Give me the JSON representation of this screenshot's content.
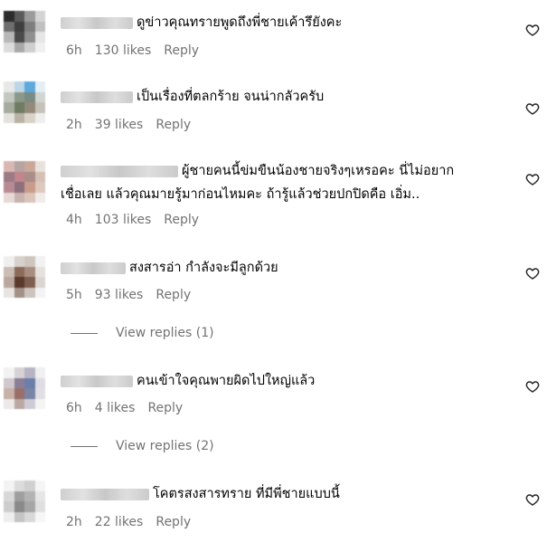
{
  "comments": [
    {
      "text_line1": "ดูข่าวคุณทรายพูดถึงพี่ชายเค้ารึยังคะ",
      "text_line2": "",
      "time": "6h",
      "likes": "130 likes",
      "reply": "Reply"
    },
    {
      "text_line1": "เป็นเรื่องที่ตลกร้าย จนน่ากลัวครับ",
      "text_line2": "",
      "time": "2h",
      "likes": "39 likes",
      "reply": "Reply"
    },
    {
      "text_line1": "ผู้ชายคนนี้ข่มขืนน้องชายจริงๆเหรอคะ นี่ไม่อยาก",
      "text_line2": "เชื่อเลย แล้วคุณมายรู้มาก่อนไหมคะ ถ้ารู้แล้วช่วยปกปิดคือ เอิ่ม..",
      "time": "4h",
      "likes": "103 likes",
      "reply": "Reply"
    },
    {
      "text_line1": "สงสารอ่า กำลังจะมีลูกด้วย",
      "text_line2": "",
      "time": "5h",
      "likes": "93 likes",
      "reply": "Reply"
    },
    {
      "text_line1": "คนเข้าใจคุณพายผิดไปใหญ่แล้ว",
      "text_line2": "",
      "time": "6h",
      "likes": "4 likes",
      "reply": "Reply"
    },
    {
      "text_line1": "โคตรสงสารทราย ที่มีพี่ชายแบบนี้",
      "text_line2": "",
      "time": "2h",
      "likes": "22 likes",
      "reply": "Reply"
    }
  ],
  "view_replies": [
    {
      "label": "View replies (1)"
    },
    {
      "label": "View replies (2)"
    }
  ],
  "icons": {
    "like": "heart-outline-icon"
  },
  "colors": {
    "meta": "#737373",
    "text": "#000000",
    "background": "#ffffff"
  }
}
